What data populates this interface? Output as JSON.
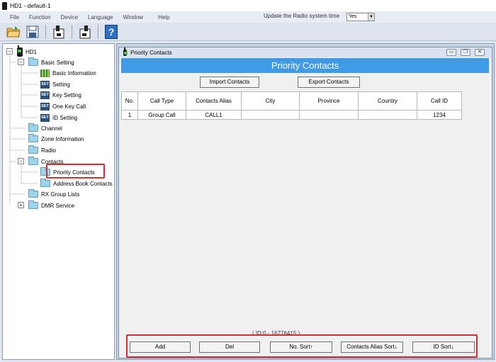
{
  "app": {
    "title": "HD1  -  default-1"
  },
  "menu": {
    "items": [
      "File",
      "Function",
      "Device",
      "Language",
      "Window",
      "Help"
    ],
    "update_label": "Update the Radio system time",
    "update_value": "Yes"
  },
  "toolbar": {
    "icons": [
      "open-folder-icon",
      "save-icon",
      "read-device-icon",
      "write-device-icon",
      "help-icon"
    ],
    "help_glyph": "?"
  },
  "tree": {
    "root": "HD1",
    "basic_setting": "Basic Setting",
    "basic_information": "Basic Information",
    "set_icon": "SET",
    "setting": "Setting",
    "key_setting": "Key Setting",
    "one_key_call": "One Key Call",
    "id_setting": "ID Setting",
    "channel": "Channel",
    "zone_information": "Zone Information",
    "radio": "Radio",
    "contacts": "Contacts",
    "priority_contacts": "Priority Contacts",
    "address_book_contacts": "Address Book Contacts",
    "rx_group_lists": "RX Group Lists",
    "dmr_service": "DMR Service"
  },
  "window": {
    "title": "Priority Contacts",
    "banner": "Priority Contacts",
    "import_label": "Import Contacts",
    "export_label": "Export Contacts",
    "columns": [
      "No.",
      "Call Type",
      "Contacts Alias",
      "City",
      "Province",
      "Country",
      "Call ID"
    ],
    "rows": [
      [
        "1",
        "Group Call",
        "CALL1",
        "",
        "",
        "",
        "1234"
      ]
    ],
    "id_range": "( ID:0 - 16776415 )",
    "buttons": {
      "add": "Add",
      "del": "Del",
      "no_sort": "No. Sort↑",
      "alias_sort": "Contacts Alias Sort↓",
      "id_sort": "ID Sort↓"
    }
  },
  "colors": {
    "banner": "#3f9be8",
    "highlight_box": "#d03030"
  }
}
